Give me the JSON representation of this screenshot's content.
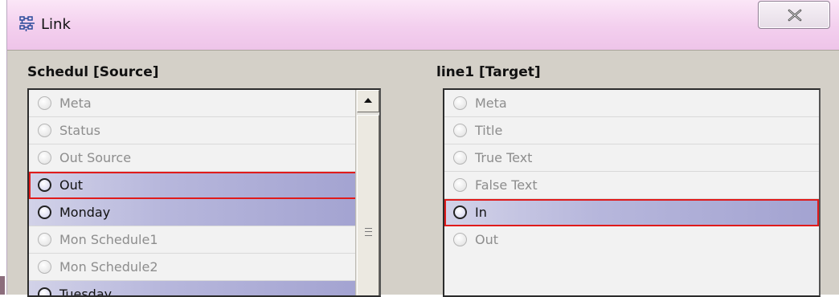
{
  "window": {
    "title": "Link",
    "icon": "link-grid-icon",
    "close_icon": "close-icon"
  },
  "source": {
    "header": "Schedul [Source]",
    "items": [
      {
        "label": "Meta",
        "state": "disabled"
      },
      {
        "label": "Status",
        "state": "disabled"
      },
      {
        "label": "Out Source",
        "state": "disabled"
      },
      {
        "label": "Out",
        "state": "selected"
      },
      {
        "label": "Monday",
        "state": "available"
      },
      {
        "label": "Mon Schedule1",
        "state": "disabled"
      },
      {
        "label": "Mon Schedule2",
        "state": "disabled"
      },
      {
        "label": "Tuesday",
        "state": "available"
      }
    ]
  },
  "target": {
    "header": "line1 [Target]",
    "items": [
      {
        "label": "Meta",
        "state": "disabled"
      },
      {
        "label": "Title",
        "state": "disabled"
      },
      {
        "label": "True Text",
        "state": "disabled"
      },
      {
        "label": "False Text",
        "state": "disabled"
      },
      {
        "label": "In",
        "state": "selected"
      },
      {
        "label": "Out",
        "state": "disabled"
      }
    ]
  },
  "colors": {
    "title_bar": "#f3cfee",
    "dialog_bg": "#d4d0c8",
    "highlight": "#a3a3d1",
    "selection_outline": "#e01b1b"
  }
}
